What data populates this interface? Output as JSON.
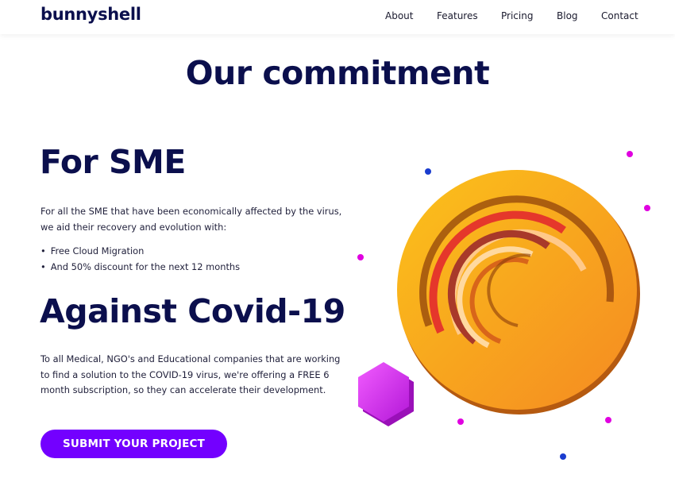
{
  "nav": {
    "logo": "bunnyshell",
    "items": [
      "About",
      "Features",
      "Pricing",
      "Blog",
      "Contact"
    ]
  },
  "page": {
    "title": "Our commitment"
  },
  "sme": {
    "heading": "For SME",
    "paragraph": "For all the SME that have been economically affected by the virus, we aid their recovery and evolution with:",
    "bullets": [
      "Free Cloud Migration",
      "And 50% discount for the next 12 months"
    ]
  },
  "covid": {
    "heading": "Against Covid-19",
    "paragraph": "To all Medical, NGO's and Educational companies that are working to find a solution to the COVID-19 virus, we're offering a FREE 6 month subscription, so they can accelerate their development."
  },
  "cta": {
    "label": "SUBMIT YOUR PROJECT"
  },
  "colors": {
    "brand_navy": "#0b0f4d",
    "cta_purple": "#7300ff",
    "coin_orange": "#f59a1c",
    "accent_magenta": "#e000e0",
    "accent_blue": "#1a3ccf"
  }
}
